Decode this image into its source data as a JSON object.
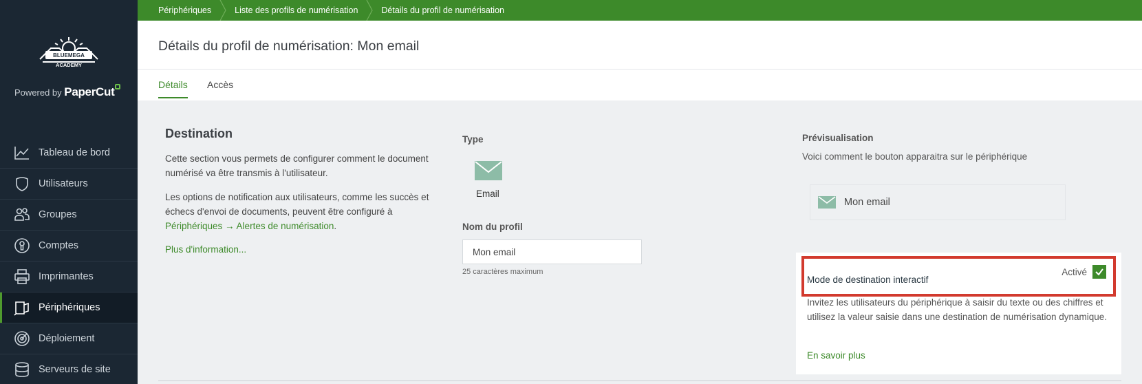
{
  "sidebar": {
    "powered_by": "Powered by",
    "brand": "PaperCut",
    "items": [
      {
        "label": "Tableau de bord",
        "icon": "chart-line-icon"
      },
      {
        "label": "Utilisateurs",
        "icon": "user-icon"
      },
      {
        "label": "Groupes",
        "icon": "group-icon"
      },
      {
        "label": "Comptes",
        "icon": "account-icon"
      },
      {
        "label": "Imprimantes",
        "icon": "printer-icon"
      },
      {
        "label": "Périphériques",
        "icon": "device-icon",
        "active": true
      },
      {
        "label": "Déploiement",
        "icon": "deployment-icon"
      },
      {
        "label": "Serveurs de site",
        "icon": "database-icon"
      }
    ]
  },
  "breadcrumb": [
    "Périphériques",
    "Liste des profils de numérisation",
    "Détails du profil de numérisation"
  ],
  "header": {
    "title": "Détails du profil de numérisation: Mon email",
    "tabs": [
      {
        "label": "Détails",
        "active": true
      },
      {
        "label": "Accès",
        "active": false
      }
    ]
  },
  "destination": {
    "title": "Destination",
    "para1": "Cette section vous permets de configurer comment le document numérisé va être transmis à l'utilisateur.",
    "para2_prefix": "Les options de notification aux utilisateurs, comme les succès et échecs d'envoi de documents, peuvent être configuré à",
    "para2_link": "Périphériques → Alertes de numérisation",
    "para2_suffix": ".",
    "more_info": "Plus d'information..."
  },
  "type": {
    "label": "Type",
    "value": "Email",
    "icon": "envelope-icon"
  },
  "profile_name": {
    "label": "Nom du profil",
    "value": "Mon email",
    "hint": "25 caractères maximum"
  },
  "preview": {
    "label": "Prévisualisation",
    "description": "Voici comment le bouton apparaitra sur le périphérique",
    "button_label": "Mon email"
  },
  "interactive": {
    "title": "Mode de destination interactif",
    "toggle_label": "Activé",
    "enabled": true,
    "description": "Invitez les utilisateurs du périphérique à saisir du texte ou des chiffres et utilisez la valeur saisie dans une destination de numérisation dynamique.",
    "learn_more": "En savoir plus"
  },
  "colors": {
    "accent_green": "#3d8a2a",
    "sidebar_bg": "#1b2733",
    "highlight_red": "#d23a2e",
    "envelope": "#8dbca7"
  }
}
